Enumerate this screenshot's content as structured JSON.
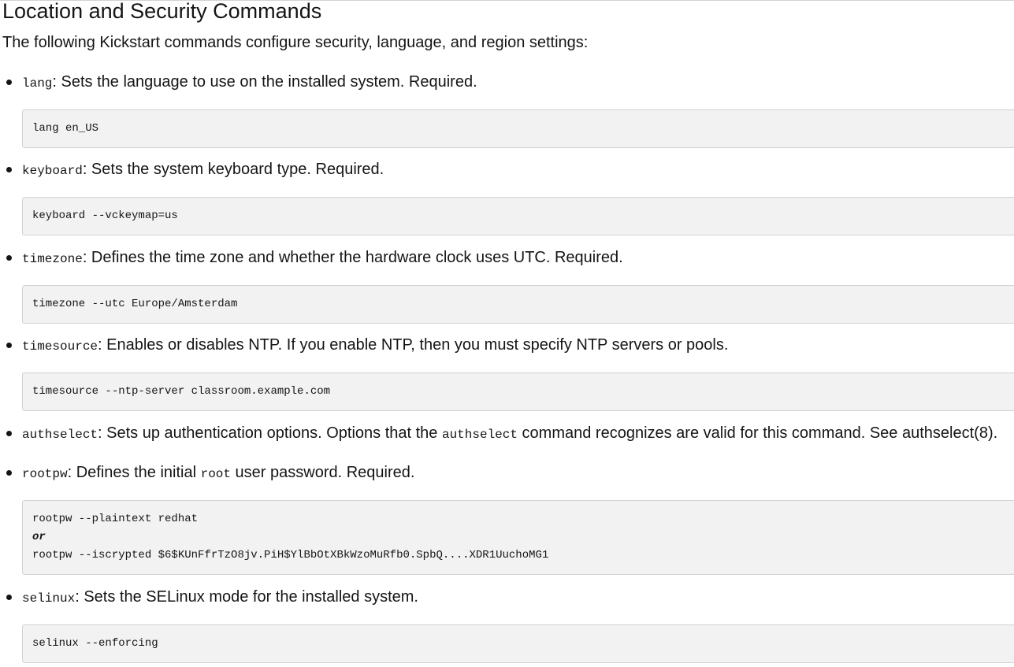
{
  "heading": "Location and Security Commands",
  "intro": "The following Kickstart commands configure security, language, and region settings:",
  "items": [
    {
      "cmd": "lang",
      "desc": ": Sets the language to use on the installed system. Required.",
      "code": "lang en_US"
    },
    {
      "cmd": "keyboard",
      "desc": ": Sets the system keyboard type. Required.",
      "code": "keyboard --vckeymap=us"
    },
    {
      "cmd": "timezone",
      "desc": ": Defines the time zone and whether the hardware clock uses UTC. Required.",
      "code": "timezone --utc Europe/Amsterdam"
    },
    {
      "cmd": "timesource",
      "desc": ": Enables or disables NTP. If you enable NTP, then you must specify NTP servers or pools.",
      "code": "timesource --ntp-server classroom.example.com"
    },
    {
      "cmd": "authselect",
      "desc_a": ": Sets up authentication options. Options that the ",
      "inline": "authselect",
      "desc_b": " command recognizes are valid for this command. See authselect(8)."
    },
    {
      "cmd": "rootpw",
      "desc_a": ": Defines the initial ",
      "inline": "root",
      "desc_b": " user password. Required.",
      "code_line1": "rootpw --plaintext redhat",
      "code_or": "or",
      "code_line2": "rootpw --iscrypted $6$KUnFfrTzO8jv.PiH$YlBbOtXBkWzoMuRfb0.SpbQ....XDR1UuchoMG1"
    },
    {
      "cmd": "selinux",
      "desc": ": Sets the SELinux mode for the installed system.",
      "code": "selinux --enforcing"
    }
  ]
}
